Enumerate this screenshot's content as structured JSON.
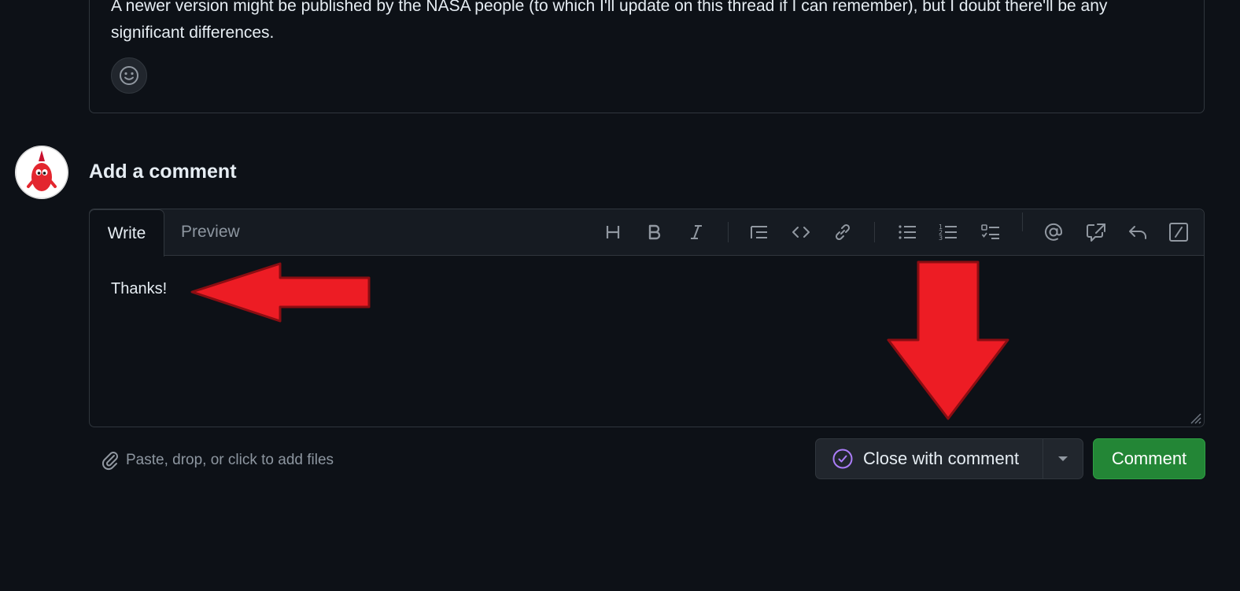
{
  "previous_comment": {
    "text": "A newer version might be published by the NASA people (to which I'll update on this thread if I can remember), but I doubt there'll be any significant differences."
  },
  "composer": {
    "heading": "Add a comment",
    "tabs": [
      {
        "label": "Write",
        "active": true
      },
      {
        "label": "Preview",
        "active": false
      }
    ],
    "toolbar_icons": [
      "heading-icon",
      "bold-icon",
      "italic-icon",
      "quote-icon",
      "code-icon",
      "link-icon",
      "unordered-list-icon",
      "ordered-list-icon",
      "task-list-icon",
      "mention-icon",
      "cross-reference-icon",
      "reply-icon",
      "slash-command-icon"
    ],
    "text_value": "Thanks!",
    "attach_hint": "Paste, drop, or click to add files"
  },
  "actions": {
    "close_label": "Close with comment",
    "comment_label": "Comment"
  },
  "colors": {
    "background": "#0d1117",
    "border": "#30363d",
    "accent_green": "#238636",
    "close_icon_purple": "#ab7df8",
    "annotation_red": "#ed1c24"
  }
}
